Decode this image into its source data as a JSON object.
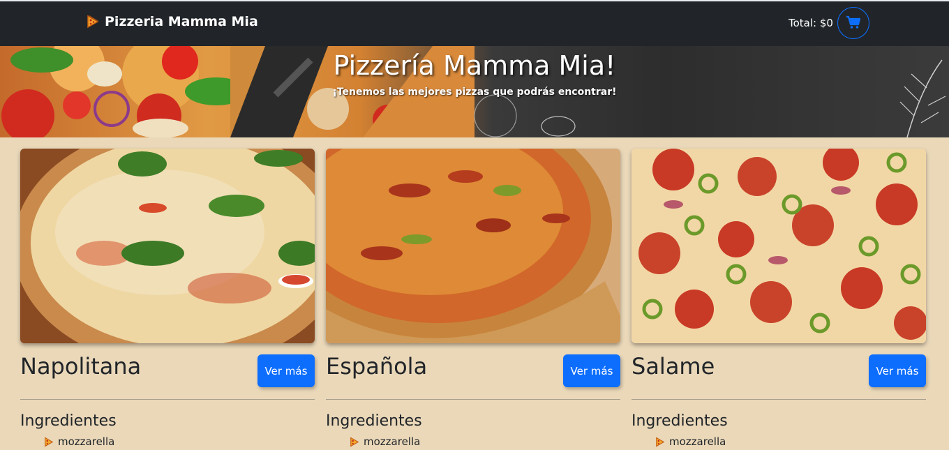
{
  "navbar": {
    "brand": "Pizzeria Mamma Mia",
    "total": "Total: $0",
    "brand_icon": "pizza-slice-icon",
    "cart_icon": "cart-icon"
  },
  "hero": {
    "title": "Pizzería Mamma Mia!",
    "subtitle": "¡Tenemos las mejores pizzas que podrás encontrar!"
  },
  "pizzas": [
    {
      "name": "Napolitana",
      "button": "Ver más",
      "ingredients_title": "Ingredientes",
      "ingredients": [
        "mozzarella"
      ]
    },
    {
      "name": "Española",
      "button": "Ver más",
      "ingredients_title": "Ingredientes",
      "ingredients": [
        "mozzarella"
      ]
    },
    {
      "name": "Salame",
      "button": "Ver más",
      "ingredients_title": "Ingredientes",
      "ingredients": [
        "mozzarella"
      ]
    }
  ],
  "colors": {
    "navbar_bg": "#212529",
    "page_bg": "#ead8b9",
    "primary": "#0d6efd"
  }
}
